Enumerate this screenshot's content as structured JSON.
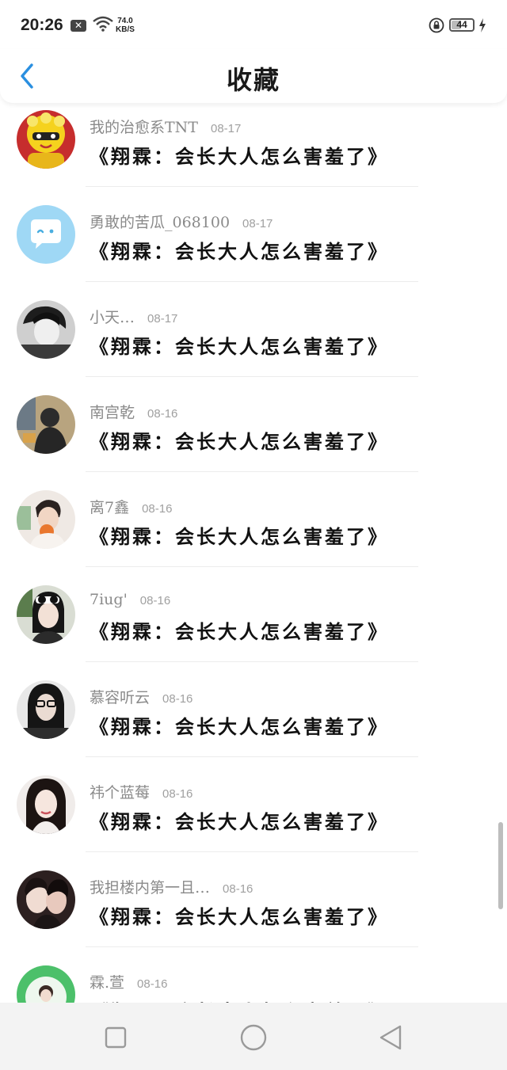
{
  "status_bar": {
    "time": "20:26",
    "network_speed_value": "74.0",
    "network_speed_unit": "KB/S",
    "battery": "44"
  },
  "header": {
    "title": "收藏"
  },
  "favorites": [
    {
      "name": "我的治愈系TNT",
      "date": "08-17",
      "content": "《翔霖：会长大人怎么害羞了》",
      "avatar": "cartoon-tiger-avatar"
    },
    {
      "name": "勇敢的苦瓜_068100",
      "date": "08-17",
      "content": "《翔霖：会长大人怎么害羞了》",
      "avatar": "default-chat-avatar"
    },
    {
      "name": "小天…",
      "date": "08-17",
      "content": "《翔霖：会长大人怎么害羞了》",
      "avatar": "bw-photo-avatar"
    },
    {
      "name": "南宫乾",
      "date": "08-16",
      "content": "《翔霖：会长大人怎么害羞了》",
      "avatar": "hooded-person-avatar"
    },
    {
      "name": "离7鑫",
      "date": "08-16",
      "content": "《翔霖：会长大人怎么害羞了》",
      "avatar": "person-eating-avatar"
    },
    {
      "name": "7iug'",
      "date": "08-16",
      "content": "《翔霖：会长大人怎么害羞了》",
      "avatar": "sunglasses-girl-avatar"
    },
    {
      "name": "慕容听云",
      "date": "08-16",
      "content": "《翔霖：会长大人怎么害羞了》",
      "avatar": "glasses-girl-avatar"
    },
    {
      "name": "祎个蓝莓",
      "date": "08-16",
      "content": "《翔霖：会长大人怎么害羞了》",
      "avatar": "portrait-girl-avatar"
    },
    {
      "name": "我担楼内第一且…",
      "date": "08-16",
      "content": "《翔霖：会长大人怎么害羞了》",
      "avatar": "couple-photo-avatar"
    },
    {
      "name": "霖.萱",
      "date": "08-16",
      "content": "《翔霖：会长大人怎么害羞了》",
      "avatar": "green-badge-avatar"
    }
  ],
  "colors": {
    "accent": "#2a8fe0",
    "text_primary": "#111111",
    "text_secondary": "#8a8a8a",
    "background": "#ffffff",
    "navbar": "#f3f3f3"
  }
}
